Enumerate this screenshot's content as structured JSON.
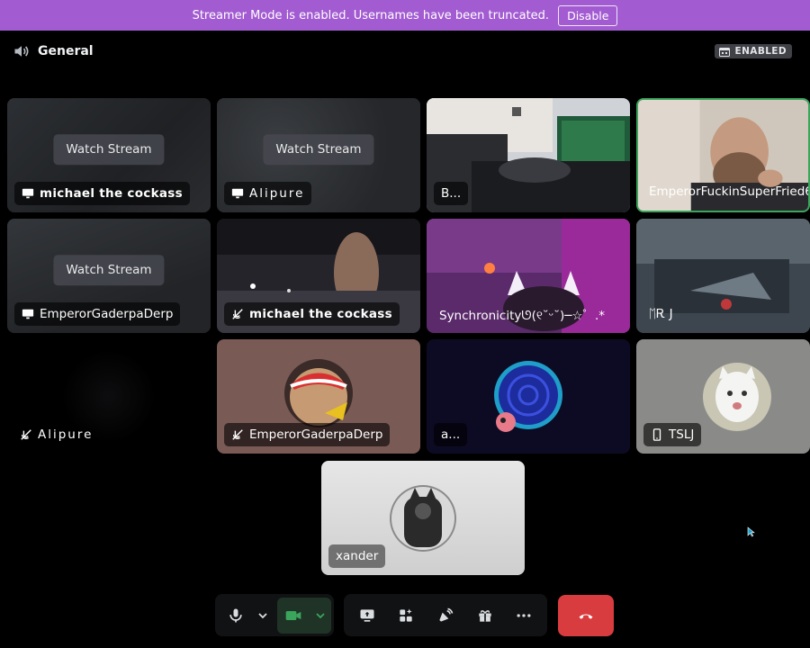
{
  "banner": {
    "message": "Streamer Mode is enabled. Usernames have been truncated.",
    "disable_label": "Disable",
    "color": "#a25bd1"
  },
  "channel": {
    "name": "General",
    "icon": "speaker-icon"
  },
  "status_badge": {
    "label": "ENABLED",
    "icon": "calendar-icon"
  },
  "tiles": [
    {
      "name": "michael the cockass",
      "icon": "screen-share-icon",
      "watch_label": "Watch Stream"
    },
    {
      "name": "Alipure",
      "icon": "screen-share-icon",
      "watch_label": "Watch Stream"
    },
    {
      "name": "B..."
    },
    {
      "name": "EmperorFuckinSuperFried6"
    },
    {
      "name": "EmperorGaderpaDerp",
      "icon": "screen-share-icon",
      "watch_label": "Watch Stream"
    },
    {
      "name": "michael the cockass",
      "icon": "muted-icon"
    },
    {
      "name": "Synchronicityᘎ(୧˘ᵕ˘)─☆゜.*"
    },
    {
      "name": "ᛖᎡ J"
    },
    {
      "name": "Alipure",
      "icon": "muted-icon"
    },
    {
      "name": "EmperorGaderpaDerp",
      "icon": "muted-icon"
    },
    {
      "name": "a..."
    },
    {
      "name": "TSLJ",
      "icon": "mobile-icon"
    },
    {
      "name": "xander"
    }
  ],
  "controls": {
    "mic": "microphone-icon",
    "camera": "camera-icon",
    "share": "screen-share-icon",
    "activities": "activities-icon",
    "soundboard": "soundboard-icon",
    "gift": "gift-icon",
    "more": "more-icon",
    "disconnect": "phone-hangup-icon"
  },
  "colors": {
    "speaking": "#3ba55c",
    "hangup": "#d83c3e",
    "camera_active": "#3ba55c"
  }
}
